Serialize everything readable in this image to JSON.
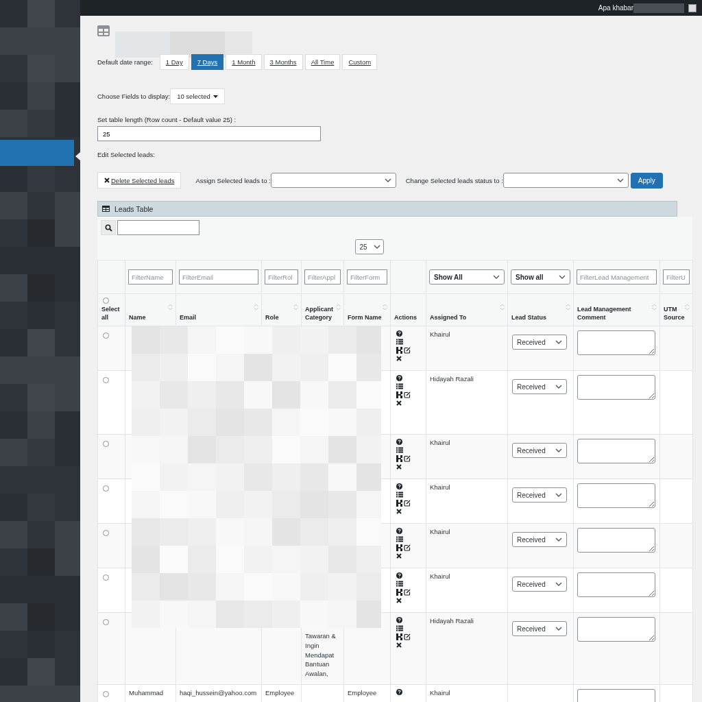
{
  "admin_bar": {
    "greeting": "Apa khabar"
  },
  "date_range": {
    "label": "Default date range:",
    "options": [
      {
        "label": "1 Day",
        "selected": false
      },
      {
        "label": "7 Days",
        "selected": true
      },
      {
        "label": "1 Month",
        "selected": false
      },
      {
        "label": "3 Months",
        "selected": false
      },
      {
        "label": "All Time",
        "selected": false
      },
      {
        "label": "Custom",
        "selected": false
      }
    ]
  },
  "fields": {
    "label": "Choose Fields to display:",
    "value": "10 selected"
  },
  "table_length": {
    "label": "Set table length (Row count - Default value 25) :",
    "value": "25"
  },
  "edit": {
    "label": "Edit Selected leads:",
    "delete_button": "Delete Selected leads",
    "assign_label": "Assign Selected leads to :",
    "status_label": "Change Selected leads status to :",
    "apply_button": "Apply"
  },
  "leads_table": {
    "title": "Leads Table",
    "page_length": "25",
    "select_all": {
      "checked": false
    },
    "filters": [
      {
        "kind": "none"
      },
      {
        "kind": "text",
        "placeholder": "FilterName"
      },
      {
        "kind": "text",
        "placeholder": "FilterEmail"
      },
      {
        "kind": "text",
        "placeholder": "FilterRol"
      },
      {
        "kind": "text",
        "placeholder": "FilterAppl"
      },
      {
        "kind": "text",
        "placeholder": "FilterForm"
      },
      {
        "kind": "none"
      },
      {
        "kind": "select",
        "value": "Show All"
      },
      {
        "kind": "select",
        "value": "Show all"
      },
      {
        "kind": "text",
        "placeholder": "FilterLead Management"
      },
      {
        "kind": "text",
        "placeholder": "FilterU"
      }
    ],
    "columns": [
      {
        "label": "Select all",
        "sortable": false
      },
      {
        "label": "Name",
        "sortable": true
      },
      {
        "label": "Email",
        "sortable": true
      },
      {
        "label": "Role",
        "sortable": true
      },
      {
        "label": "Applicant Category",
        "sortable": true
      },
      {
        "label": "Form Name",
        "sortable": true
      },
      {
        "label": "Actions",
        "sortable": false
      },
      {
        "label": "Assigned To",
        "sortable": true
      },
      {
        "label": "Lead Status",
        "sortable": true
      },
      {
        "label": "Lead Management Comment",
        "sortable": true
      },
      {
        "label": "UTM Source",
        "sortable": true
      }
    ],
    "rows": [
      {
        "checked": false,
        "assigned_to": "Khairul",
        "lead_status": "Received"
      },
      {
        "checked": false,
        "assigned_to": "Hidayah Razali",
        "lead_status": "Received"
      },
      {
        "checked": false,
        "assigned_to": "Khairul",
        "lead_status": "Received"
      },
      {
        "checked": false,
        "assigned_to": "Khairul",
        "lead_status": "Received"
      },
      {
        "checked": false,
        "assigned_to": "Khairul",
        "lead_status": "Received"
      },
      {
        "checked": false,
        "assigned_to": "Khairul",
        "lead_status": "Received"
      },
      {
        "checked": false,
        "assigned_to": "Hidayah Razali",
        "lead_status": "Received",
        "applicant_category": "Tawaran & Ingin Mendapat Bantuan Awalan,"
      },
      {
        "checked": false,
        "name": "Muhammad",
        "email": "haqi_hussein@yahoo.com",
        "role": "Employee",
        "form_name": "Employee",
        "assigned_to": "Khairul"
      }
    ]
  }
}
